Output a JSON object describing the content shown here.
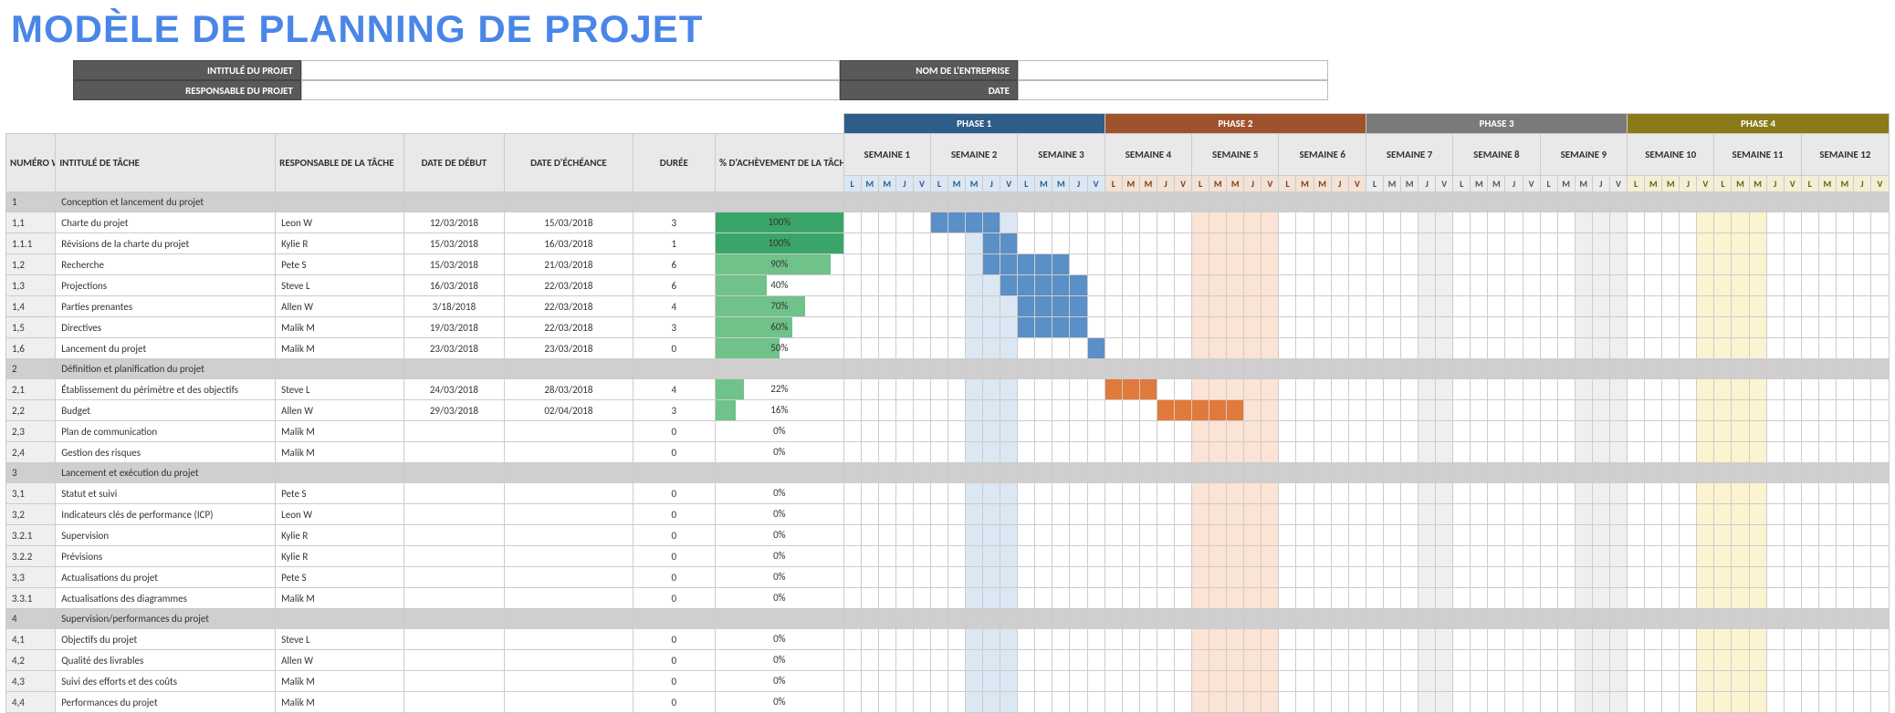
{
  "title": "MODÈLE DE PLANNING DE PROJET",
  "meta": {
    "project_label": "INTITULÉ DU PROJET",
    "manager_label": "RESPONSABLE DU PROJET",
    "company_label": "NOM DE L'ENTREPRISE",
    "date_label": "DATE"
  },
  "columns": {
    "wbs": "NUMÉRO WBS",
    "task": "INTITULÉ DE TÂCHE",
    "owner": "RESPONSABLE DE LA TÂCHE",
    "start": "DATE DE DÉBUT",
    "end": "DATE D'ÉCHÉANCE",
    "dur": "DURÉE",
    "pct": "% D'ACHÈVEMENT DE LA TÂCHE"
  },
  "phases": [
    {
      "label": "PHASE 1",
      "weeks": [
        "SEMAINE 1",
        "SEMAINE 2",
        "SEMAINE 3"
      ]
    },
    {
      "label": "PHASE 2",
      "weeks": [
        "SEMAINE 4",
        "SEMAINE 5",
        "SEMAINE 6"
      ]
    },
    {
      "label": "PHASE 3",
      "weeks": [
        "SEMAINE 7",
        "SEMAINE 8",
        "SEMAINE 9"
      ]
    },
    {
      "label": "PHASE 4",
      "weeks": [
        "SEMAINE 10",
        "SEMAINE 11",
        "SEMAINE 12"
      ]
    }
  ],
  "days": [
    "L",
    "M",
    "M",
    "J",
    "V"
  ],
  "rows": [
    {
      "type": "section",
      "wbs": "1",
      "task": "Conception et lancement du projet"
    },
    {
      "type": "task",
      "wbs": "1,1",
      "task": "Charte du projet",
      "owner": "Leon W",
      "start": "12/03/2018",
      "end": "15/03/2018",
      "dur": "3",
      "pct": 100,
      "bar": {
        "start": 5,
        "len": 4,
        "class": "g-blue"
      }
    },
    {
      "type": "task",
      "wbs": "1.1.1",
      "task": "Révisions de la charte du projet",
      "owner": "Kylie R",
      "start": "15/03/2018",
      "end": "16/03/2018",
      "dur": "1",
      "pct": 100,
      "bar": {
        "start": 8,
        "len": 2,
        "class": "g-blue"
      }
    },
    {
      "type": "task",
      "wbs": "1,2",
      "task": "Recherche",
      "owner": "Pete S",
      "start": "15/03/2018",
      "end": "21/03/2018",
      "dur": "6",
      "pct": 90,
      "bar": {
        "start": 8,
        "len": 5,
        "class": "g-blue"
      }
    },
    {
      "type": "task",
      "wbs": "1,3",
      "task": "Projections",
      "owner": "Steve L",
      "start": "16/03/2018",
      "end": "22/03/2018",
      "dur": "6",
      "pct": 40,
      "bar": {
        "start": 9,
        "len": 5,
        "class": "g-blue"
      }
    },
    {
      "type": "task",
      "wbs": "1,4",
      "task": "Parties prenantes",
      "owner": "Allen W",
      "start": "3/18/2018",
      "end": "22/03/2018",
      "dur": "4",
      "pct": 70,
      "bar": {
        "start": 10,
        "len": 4,
        "class": "g-blue"
      }
    },
    {
      "type": "task",
      "wbs": "1,5",
      "task": "Directives",
      "owner": "Malik M",
      "start": "19/03/2018",
      "end": "22/03/2018",
      "dur": "3",
      "pct": 60,
      "bar": {
        "start": 10,
        "len": 4,
        "class": "g-blue"
      }
    },
    {
      "type": "task",
      "wbs": "1,6",
      "task": "Lancement du projet",
      "owner": "Malik M",
      "start": "23/03/2018",
      "end": "23/03/2018",
      "dur": "0",
      "pct": 50,
      "bar": {
        "start": 14,
        "len": 1,
        "class": "g-blue"
      }
    },
    {
      "type": "section",
      "wbs": "2",
      "task": "Définition et planification du projet"
    },
    {
      "type": "task",
      "wbs": "2,1",
      "task": "Établissement du périmètre et des objectifs",
      "owner": "Steve L",
      "start": "24/03/2018",
      "end": "28/03/2018",
      "dur": "4",
      "pct": 22,
      "bar": {
        "start": 15,
        "len": 3,
        "class": "g-orange"
      }
    },
    {
      "type": "task",
      "wbs": "2,2",
      "task": "Budget",
      "owner": "Allen W",
      "start": "29/03/2018",
      "end": "02/04/2018",
      "dur": "3",
      "pct": 16,
      "bar": {
        "start": 18,
        "len": 5,
        "class": "g-orange"
      }
    },
    {
      "type": "task",
      "wbs": "2,3",
      "task": "Plan de communication",
      "owner": "Malik M",
      "start": "",
      "end": "",
      "dur": "0",
      "pct": 0
    },
    {
      "type": "task",
      "wbs": "2,4",
      "task": "Gestion des risques",
      "owner": "Malik M",
      "start": "",
      "end": "",
      "dur": "0",
      "pct": 0
    },
    {
      "type": "section",
      "wbs": "3",
      "task": "Lancement et exécution du projet"
    },
    {
      "type": "task",
      "wbs": "3,1",
      "task": "Statut et suivi",
      "owner": "Pete S",
      "start": "",
      "end": "",
      "dur": "0",
      "pct": 0
    },
    {
      "type": "task",
      "wbs": "3,2",
      "task": "Indicateurs clés de performance (ICP)",
      "owner": "Leon W",
      "start": "",
      "end": "",
      "dur": "0",
      "pct": 0
    },
    {
      "type": "task",
      "wbs": "3.2.1",
      "task": "Supervision",
      "owner": "Kylie R",
      "start": "",
      "end": "",
      "dur": "0",
      "pct": 0
    },
    {
      "type": "task",
      "wbs": "3.2.2",
      "task": "Prévisions",
      "owner": "Kylie R",
      "start": "",
      "end": "",
      "dur": "0",
      "pct": 0
    },
    {
      "type": "task",
      "wbs": "3,3",
      "task": "Actualisations du projet",
      "owner": "Pete S",
      "start": "",
      "end": "",
      "dur": "0",
      "pct": 0
    },
    {
      "type": "task",
      "wbs": "3.3.1",
      "task": "Actualisations des diagrammes",
      "owner": "Malik M",
      "start": "",
      "end": "",
      "dur": "0",
      "pct": 0
    },
    {
      "type": "section",
      "wbs": "4",
      "task": "Supervision/performances du projet"
    },
    {
      "type": "task",
      "wbs": "4,1",
      "task": "Objectifs du projet",
      "owner": "Steve L",
      "start": "",
      "end": "",
      "dur": "0",
      "pct": 0
    },
    {
      "type": "task",
      "wbs": "4,2",
      "task": "Qualité des livrables",
      "owner": "Allen W",
      "start": "",
      "end": "",
      "dur": "0",
      "pct": 0
    },
    {
      "type": "task",
      "wbs": "4,3",
      "task": "Suivi des efforts et des coûts",
      "owner": "Malik M",
      "start": "",
      "end": "",
      "dur": "0",
      "pct": 0
    },
    {
      "type": "task",
      "wbs": "4,4",
      "task": "Performances du projet",
      "owner": "Malik M",
      "start": "",
      "end": "",
      "dur": "0",
      "pct": 0
    }
  ],
  "highlight_columns": {
    "blue": [
      7,
      8,
      9
    ],
    "orange": [
      20,
      21,
      22,
      23,
      24
    ],
    "grey": [
      33,
      34,
      42,
      43,
      44
    ],
    "gold": [
      49,
      50,
      51,
      52
    ]
  }
}
